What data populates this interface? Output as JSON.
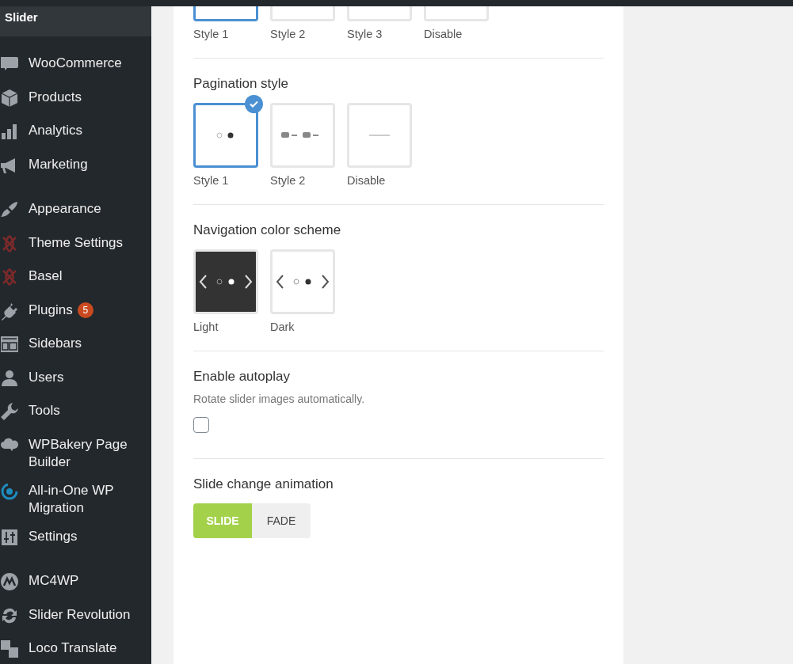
{
  "sidebar": {
    "header": "Slider",
    "groups": [
      {
        "items": [
          {
            "label": "WooCommerce"
          },
          {
            "label": "Products"
          },
          {
            "label": "Analytics"
          },
          {
            "label": "Marketing"
          }
        ]
      },
      {
        "items": [
          {
            "label": "Appearance"
          },
          {
            "label": "Theme Settings"
          },
          {
            "label": "Basel"
          },
          {
            "label": "Plugins",
            "badge": "5"
          },
          {
            "label": "Sidebars"
          },
          {
            "label": "Users"
          },
          {
            "label": "Tools"
          },
          {
            "label": "WPBakery Page Builder"
          },
          {
            "label": "All-in-One WP Migration"
          },
          {
            "label": "Settings"
          }
        ]
      },
      {
        "items": [
          {
            "label": "MC4WP"
          },
          {
            "label": "Slider Revolution"
          },
          {
            "label": "Loco Translate"
          }
        ]
      }
    ]
  },
  "sections": [
    {
      "kind": "tiles",
      "tiles": [
        {
          "label": "Style 1",
          "selected": true,
          "kind": "blank"
        },
        {
          "label": "Style 2",
          "selected": false,
          "kind": "blank"
        },
        {
          "label": "Style 3",
          "selected": false,
          "kind": "blank"
        },
        {
          "label": "Disable",
          "selected": false,
          "kind": "blank"
        }
      ]
    },
    {
      "kind": "tiles",
      "title": "Pagination style",
      "tiles": [
        {
          "label": "Style 1",
          "selected": true,
          "kind": "dots"
        },
        {
          "label": "Style 2",
          "selected": false,
          "kind": "numbers"
        },
        {
          "label": "Disable",
          "selected": false,
          "kind": "line"
        }
      ]
    },
    {
      "kind": "tiles",
      "title": "Navigation color scheme",
      "tiles": [
        {
          "label": "Light",
          "selected": false,
          "kind": "nav-dark"
        },
        {
          "label": "Dark",
          "selected": false,
          "kind": "nav-light"
        }
      ]
    },
    {
      "kind": "checkbox",
      "title": "Enable autoplay",
      "description": "Rotate slider images automatically.",
      "checked": false
    },
    {
      "kind": "segmented",
      "title": "Slide change animation",
      "options": [
        {
          "label": "SLIDE",
          "selected": true
        },
        {
          "label": "FADE",
          "selected": false
        }
      ]
    }
  ]
}
